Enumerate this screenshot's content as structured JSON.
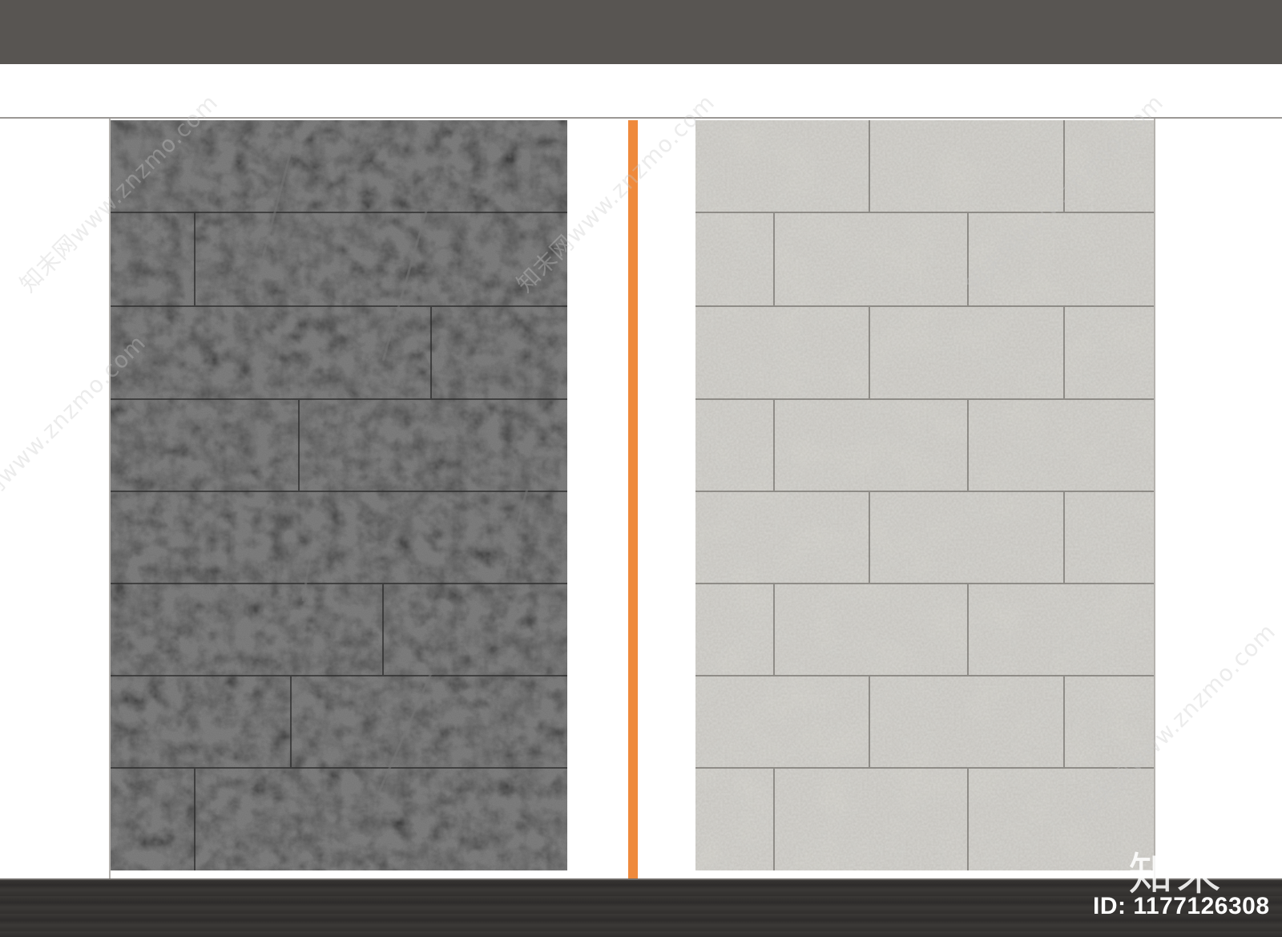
{
  "colors": {
    "top_bar": "#585552",
    "accent_strip": "#ef8a3c",
    "dark_stone": "#3d3d3d",
    "light_stone": "#c3c1bb",
    "floor": "#33312f"
  },
  "watermark": {
    "text": "知末网www.znzmo.com"
  },
  "branding": {
    "logo_text": "知末",
    "id_text": "ID: 1177126308"
  }
}
